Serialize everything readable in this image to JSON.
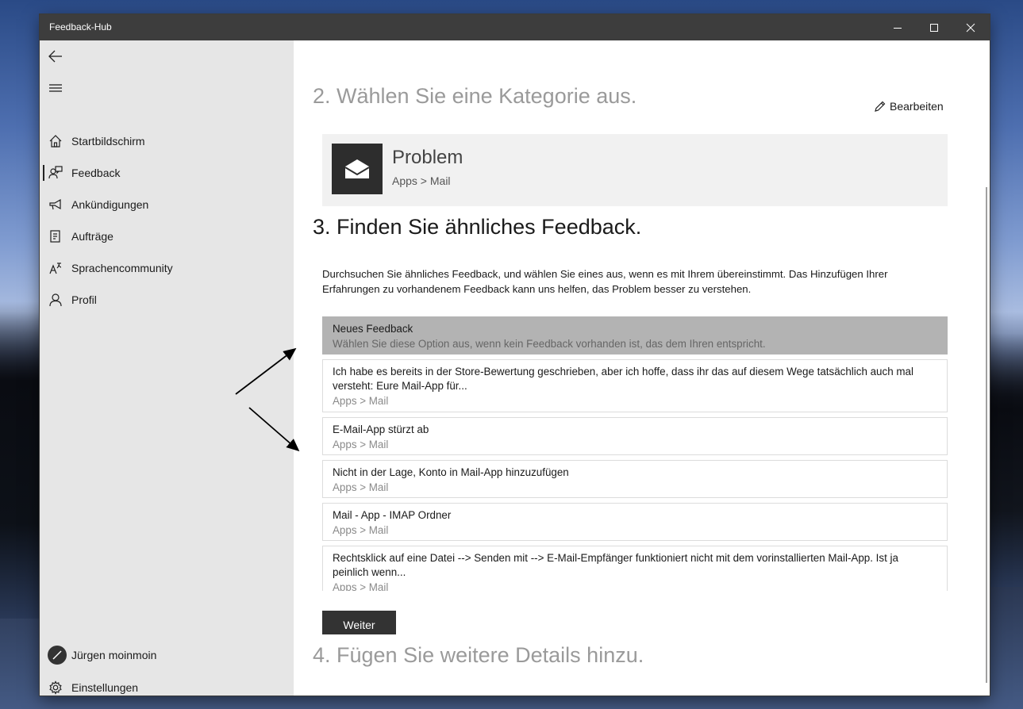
{
  "window": {
    "title": "Feedback-Hub"
  },
  "sidebar": {
    "items": [
      {
        "label": "Startbildschirm",
        "icon": "home-icon"
      },
      {
        "label": "Feedback",
        "icon": "feedback-icon",
        "active": true
      },
      {
        "label": "Ankündigungen",
        "icon": "megaphone-icon"
      },
      {
        "label": "Aufträge",
        "icon": "quests-icon"
      },
      {
        "label": "Sprachencommunity",
        "icon": "language-icon"
      },
      {
        "label": "Profil",
        "icon": "person-icon"
      }
    ],
    "user_name": "Jürgen moinmoin",
    "settings_label": "Einstellungen"
  },
  "main": {
    "step2_heading": "2. Wählen Sie eine Kategorie aus.",
    "edit_label": "Bearbeiten",
    "category": {
      "title": "Problem",
      "path": "Apps > Mail",
      "icon": "mail-envelope-icon"
    },
    "step3_heading": "3. Finden Sie ähnliches Feedback.",
    "step3_description": "Durchsuchen Sie ähnliches Feedback, und wählen Sie eines aus, wenn es mit Ihrem übereinstimmt. Das Hinzufügen Ihrer Erfahrungen zu vorhandenem Feedback kann uns helfen, das Problem besser zu verstehen.",
    "feedback_items": [
      {
        "title": "Neues Feedback",
        "subtitle": "Wählen Sie diese Option aus, wenn kein Feedback vorhanden ist, das dem Ihren entspricht.",
        "selected": true
      },
      {
        "title": "Ich habe es bereits in der Store-Bewertung geschrieben, aber ich hoffe, dass ihr das auf diesem Wege tatsächlich auch mal versteht: Eure Mail-App für...",
        "subtitle": "Apps > Mail"
      },
      {
        "title": "E-Mail-App stürzt ab",
        "subtitle": "Apps > Mail"
      },
      {
        "title": "Nicht in der Lage, Konto in Mail-App hinzuzufügen",
        "subtitle": "Apps > Mail"
      },
      {
        "title": "Mail - App - IMAP Ordner",
        "subtitle": "Apps > Mail"
      },
      {
        "title": "Rechtsklick auf eine Datei --> Senden mit --> E-Mail-Empfänger funktioniert nicht mit dem vorinstallierten Mail-App. Ist ja peinlich wenn...",
        "subtitle": "Apps > Mail"
      }
    ],
    "next_label": "Weiter",
    "step4_heading": "4. Fügen Sie weitere Details hinzu."
  },
  "colors": {
    "titlebar": "#3d3d3d",
    "sidebar": "#e6e6e6",
    "selected_item": "#b3b3b3",
    "button": "#333333"
  }
}
